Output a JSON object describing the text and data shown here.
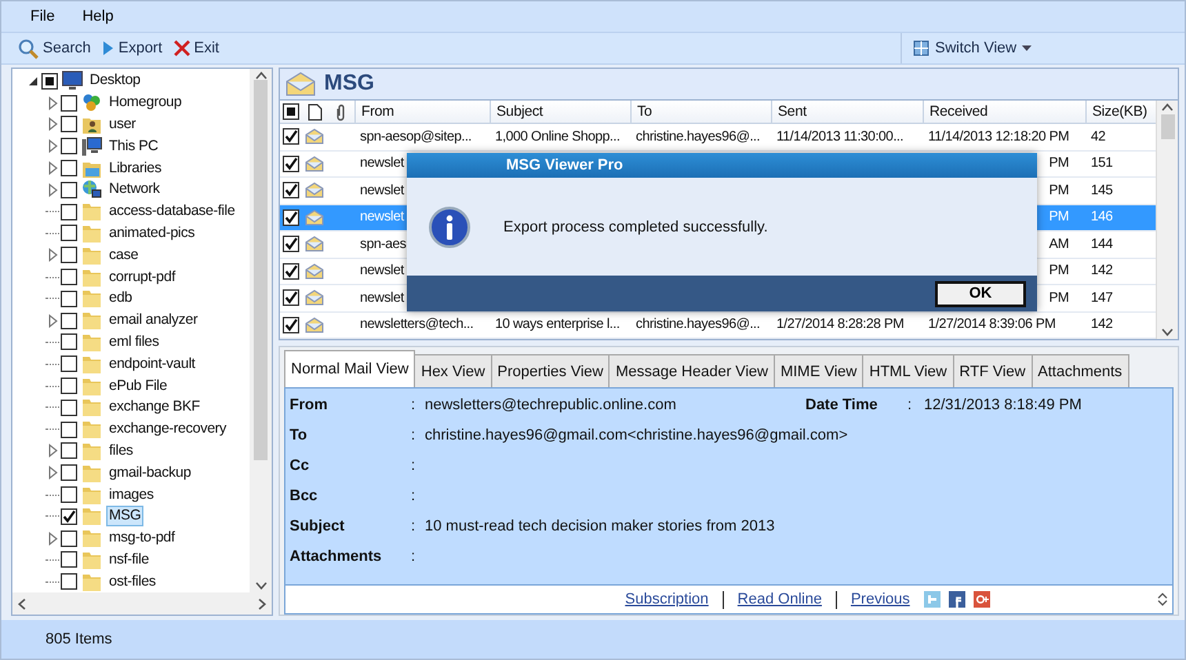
{
  "menu": [
    {
      "label": "File"
    },
    {
      "label": "Help"
    }
  ],
  "toolbar": [
    {
      "kind": "search",
      "label": "Search"
    },
    {
      "kind": "export",
      "label": "Export"
    },
    {
      "kind": "exit",
      "label": "Exit"
    }
  ],
  "switch_view": {
    "label": "Switch View"
  },
  "tree": [
    {
      "label": "Desktop",
      "kind": "desktop",
      "expanded": true,
      "mixed": true,
      "selected": false,
      "children": [
        {
          "label": "Homegroup",
          "kind": "homegroup",
          "expanded": false,
          "checked": false,
          "selected": false
        },
        {
          "label": "user",
          "kind": "user",
          "expanded": false,
          "checked": false,
          "selected": false
        },
        {
          "label": "This PC",
          "kind": "pc",
          "expanded": false,
          "checked": false,
          "selected": false
        },
        {
          "label": "Libraries",
          "kind": "libraries",
          "expanded": false,
          "checked": false,
          "selected": false
        },
        {
          "label": "Network",
          "kind": "network",
          "expanded": false,
          "checked": false,
          "selected": false
        },
        {
          "label": "access-database-file",
          "kind": "folder",
          "checked": false,
          "selected": false
        },
        {
          "label": "animated-pics",
          "kind": "folder",
          "checked": false,
          "selected": false
        },
        {
          "label": "case",
          "kind": "folder",
          "expanded": false,
          "checked": false,
          "selected": false
        },
        {
          "label": "corrupt-pdf",
          "kind": "folder",
          "checked": false,
          "selected": false
        },
        {
          "label": "edb",
          "kind": "folder",
          "checked": false,
          "selected": false
        },
        {
          "label": "email analyzer",
          "kind": "folder",
          "expanded": false,
          "checked": false,
          "selected": false
        },
        {
          "label": "eml files",
          "kind": "folder",
          "checked": false,
          "selected": false
        },
        {
          "label": "endpoint-vault",
          "kind": "folder",
          "checked": false,
          "selected": false
        },
        {
          "label": "ePub File",
          "kind": "folder",
          "checked": false,
          "selected": false
        },
        {
          "label": "exchange BKF",
          "kind": "folder",
          "checked": false,
          "selected": false
        },
        {
          "label": "exchange-recovery",
          "kind": "folder",
          "checked": false,
          "selected": false
        },
        {
          "label": "files",
          "kind": "folder",
          "expanded": false,
          "checked": false,
          "selected": false
        },
        {
          "label": "gmail-backup",
          "kind": "folder",
          "expanded": false,
          "checked": false,
          "selected": false
        },
        {
          "label": "images",
          "kind": "folder",
          "checked": false,
          "selected": false
        },
        {
          "label": "MSG",
          "kind": "folder",
          "checked": true,
          "selected": true
        },
        {
          "label": "msg-to-pdf",
          "kind": "folder",
          "expanded": false,
          "checked": false,
          "selected": false
        },
        {
          "label": "nsf-file",
          "kind": "folder",
          "checked": false,
          "selected": false
        },
        {
          "label": "ost-files",
          "kind": "folder",
          "checked": false,
          "selected": false
        }
      ]
    }
  ],
  "folder_header": {
    "title": "MSG"
  },
  "table": {
    "header_checkbox": {
      "mixed": true
    },
    "columns": [
      "From",
      "Subject",
      "To",
      "Sent",
      "Received",
      "Size(KB)"
    ],
    "rows": [
      {
        "checked": true,
        "selected": false,
        "from": "spn-aesop@sitep...",
        "subject": "1,000 Online Shopp...",
        "to": "christine.hayes96@...",
        "sent": "11/14/2013 11:30:00...",
        "received": "11/14/2013 12:18:20 PM",
        "size": "42"
      },
      {
        "checked": true,
        "selected": false,
        "from": "newslet",
        "received": "PM",
        "size": "151"
      },
      {
        "checked": true,
        "selected": false,
        "from": "newslet",
        "received": "PM",
        "size": "145"
      },
      {
        "checked": true,
        "selected": true,
        "from": "newslet",
        "received": "PM",
        "size": "146"
      },
      {
        "checked": true,
        "selected": false,
        "from": "spn-aes",
        "received": "AM",
        "size": "144"
      },
      {
        "checked": true,
        "selected": false,
        "from": "newslet",
        "received": "PM",
        "size": "142"
      },
      {
        "checked": true,
        "selected": false,
        "from": "newslet",
        "received": "PM",
        "size": "147"
      },
      {
        "checked": true,
        "selected": false,
        "from": "newsletters@tech...",
        "subject": "10 ways enterprise l...",
        "to": "christine.hayes96@...",
        "sent": "1/27/2014 8:28:28 PM",
        "received": "1/27/2014 8:39:06 PM",
        "size": "142"
      }
    ]
  },
  "tabs": [
    {
      "label": "Normal Mail View",
      "selected": true
    },
    {
      "label": "Hex View",
      "selected": false
    },
    {
      "label": "Properties View",
      "selected": false
    },
    {
      "label": "Message Header View",
      "selected": false
    },
    {
      "label": "MIME View",
      "selected": false
    },
    {
      "label": "HTML View",
      "selected": false
    },
    {
      "label": "RTF View",
      "selected": false
    },
    {
      "label": "Attachments",
      "selected": false
    }
  ],
  "details": {
    "fields": [
      {
        "label": "From",
        "colon": ":",
        "value": "newsletters@techrepublic.online.com"
      },
      {
        "label": "To",
        "colon": ":",
        "value": "christine.hayes96@gmail.com<christine.hayes96@gmail.com>"
      },
      {
        "label": "Cc",
        "colon": ":"
      },
      {
        "label": "Bcc",
        "colon": ":"
      },
      {
        "label": "Subject",
        "colon": ":",
        "value": "10 must-read tech decision maker stories from 2013"
      },
      {
        "label": "Attachments",
        "colon": ":"
      }
    ],
    "date_time": {
      "label": "Date Time",
      "colon": ":",
      "value": "12/31/2013 8:18:49 PM"
    },
    "links": [
      "Subscription",
      "Read Online",
      "Previous"
    ]
  },
  "status_bar": {
    "text": "805 Items"
  },
  "dialog": {
    "title": "MSG Viewer Pro",
    "message": "Export process completed successfully.",
    "button": "OK"
  }
}
